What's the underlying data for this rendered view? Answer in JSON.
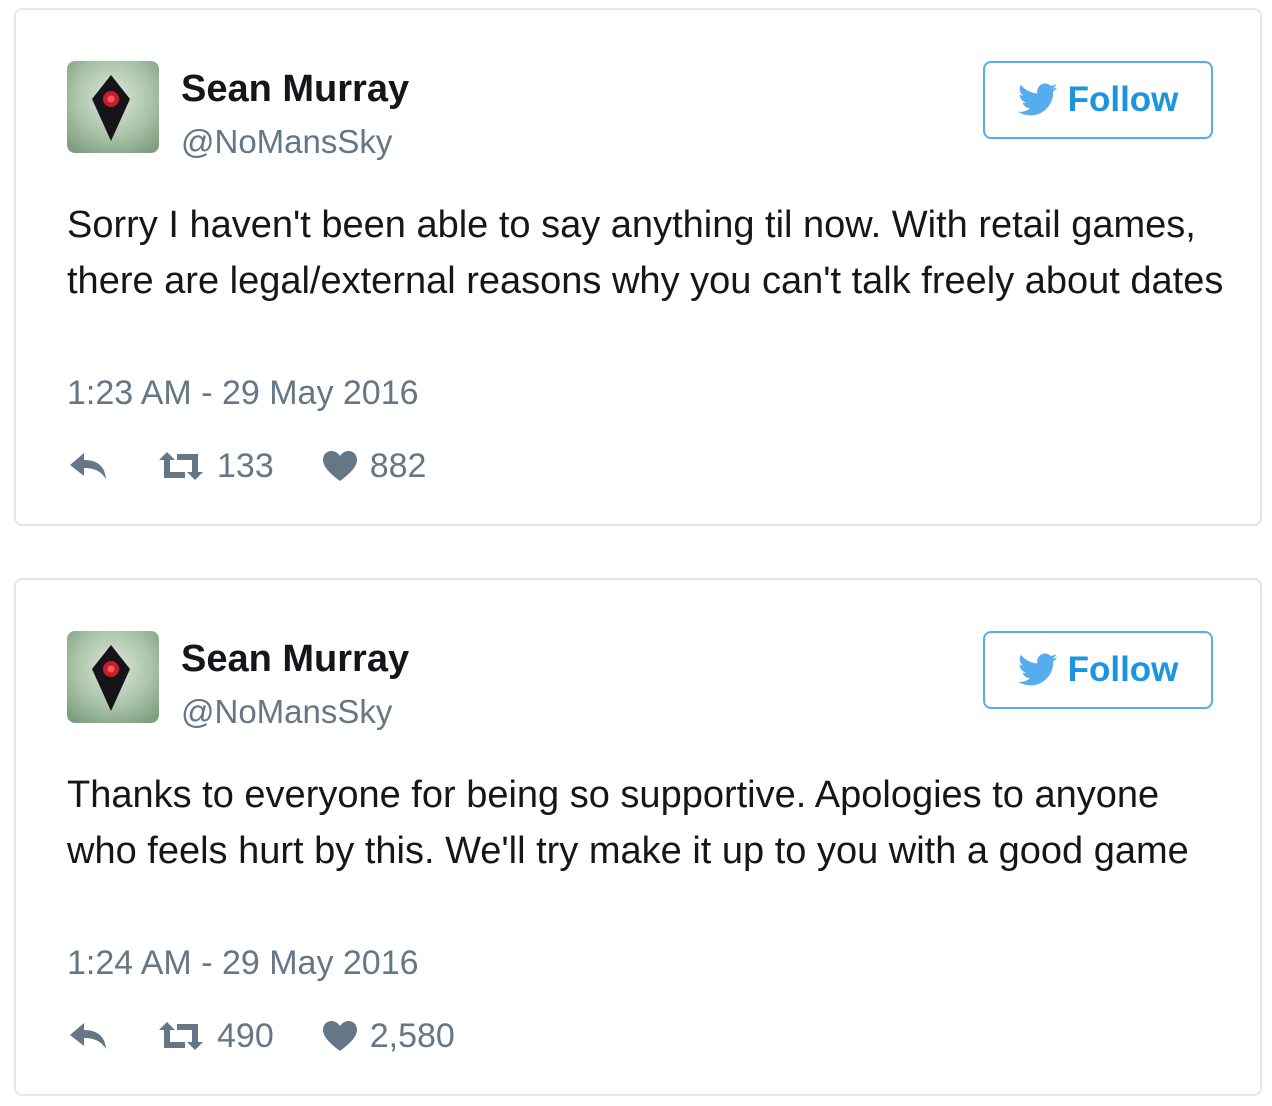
{
  "colors": {
    "border": "#e1e8ed",
    "follow_blue": "#1b95e0",
    "name_text": "#14171a",
    "muted_text": "#657786"
  },
  "tweets": [
    {
      "author_name": "Sean Murray",
      "author_handle": "@NoMansSky",
      "follow_label": "Follow",
      "text": "Sorry I haven't been able to say anything til now. With retail games, there are legal/external reasons why you can't talk freely about dates",
      "timestamp": "1:23 AM - 29 May 2016",
      "retweets": "133",
      "likes": "882",
      "icons": [
        "avatar",
        "twitter-bird-icon",
        "reply-icon",
        "retweet-icon",
        "heart-icon"
      ]
    },
    {
      "author_name": "Sean Murray",
      "author_handle": "@NoMansSky",
      "follow_label": "Follow",
      "text": "Thanks to everyone for being so supportive. Apologies to anyone who feels hurt by this. We'll try make it up to you with a good game",
      "timestamp": "1:24 AM - 29 May 2016",
      "retweets": "490",
      "likes": "2,580",
      "icons": [
        "avatar",
        "twitter-bird-icon",
        "reply-icon",
        "retweet-icon",
        "heart-icon"
      ]
    }
  ]
}
